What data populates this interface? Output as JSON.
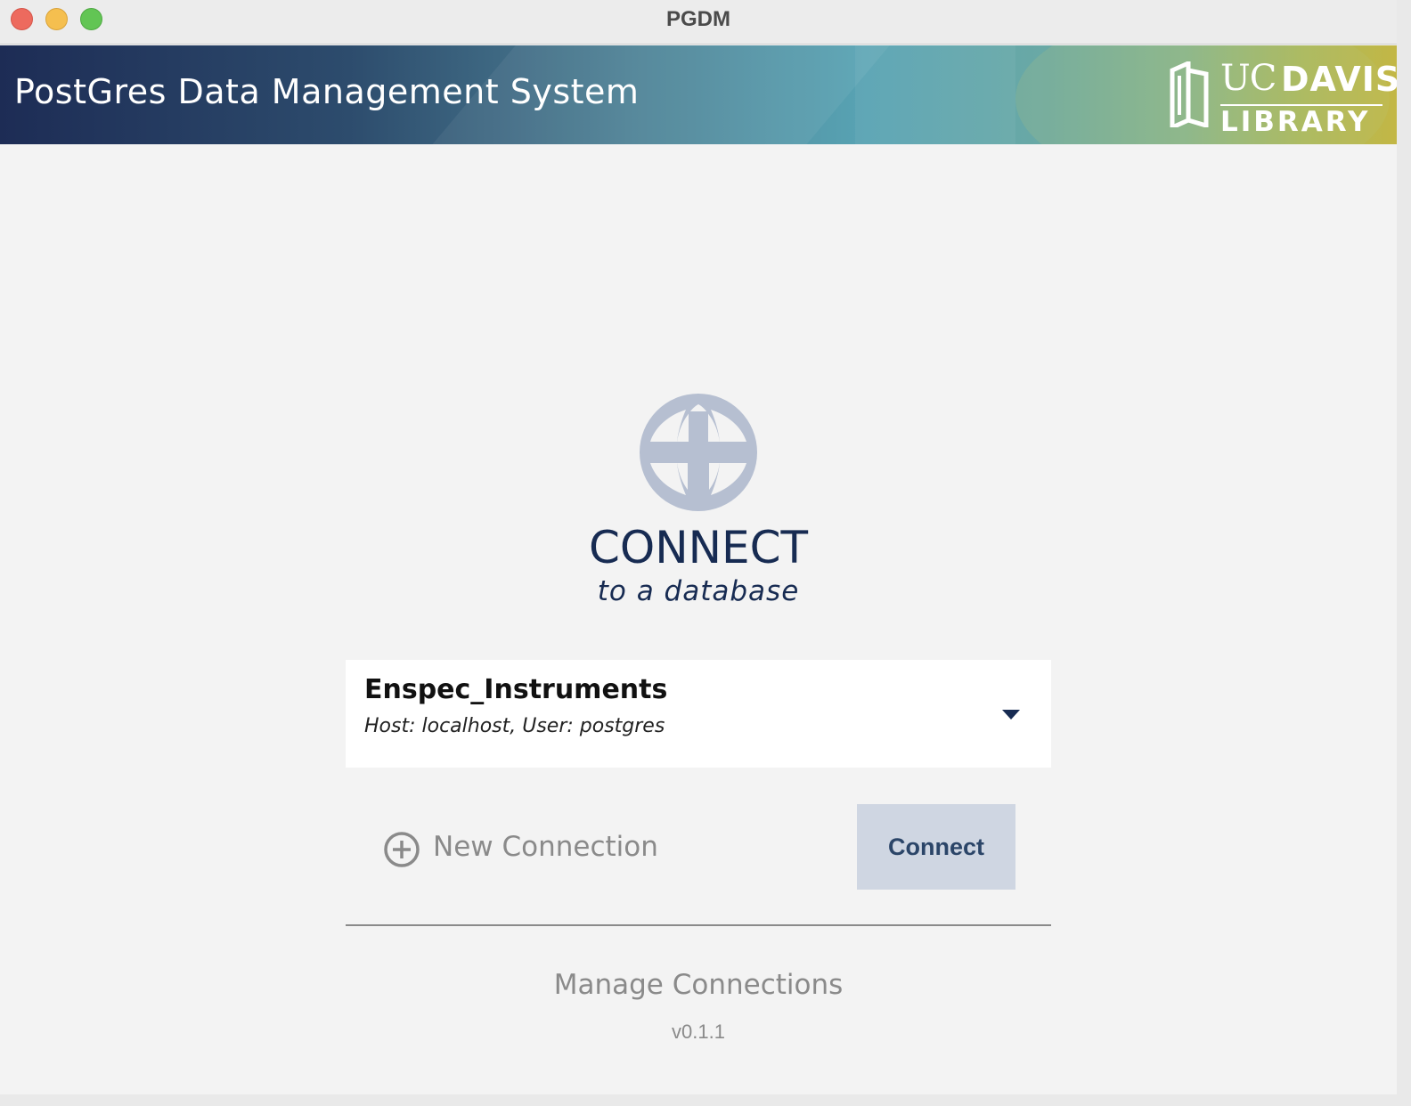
{
  "window": {
    "title": "PGDM"
  },
  "header": {
    "app_title": "PostGres Data Management System",
    "logo": {
      "uc": "UC",
      "davis": "DAVIS",
      "library": "LIBRARY",
      "icon": "ucdavis-library-logo"
    }
  },
  "main": {
    "icon": "globe-icon",
    "heading": "CONNECT",
    "subheading": "to a database",
    "connection_select": {
      "name": "Enspec_Instruments",
      "detail": "Host: localhost, User: postgres"
    },
    "new_connection_label": "New Connection",
    "connect_button_label": "Connect",
    "manage_connections_label": "Manage Connections",
    "version": "v0.1.1"
  },
  "colors": {
    "brand_navy": "#172b52",
    "globe": "#b6bfd1",
    "button_bg": "#cfd6e2",
    "muted_text": "#8a8a8a"
  }
}
